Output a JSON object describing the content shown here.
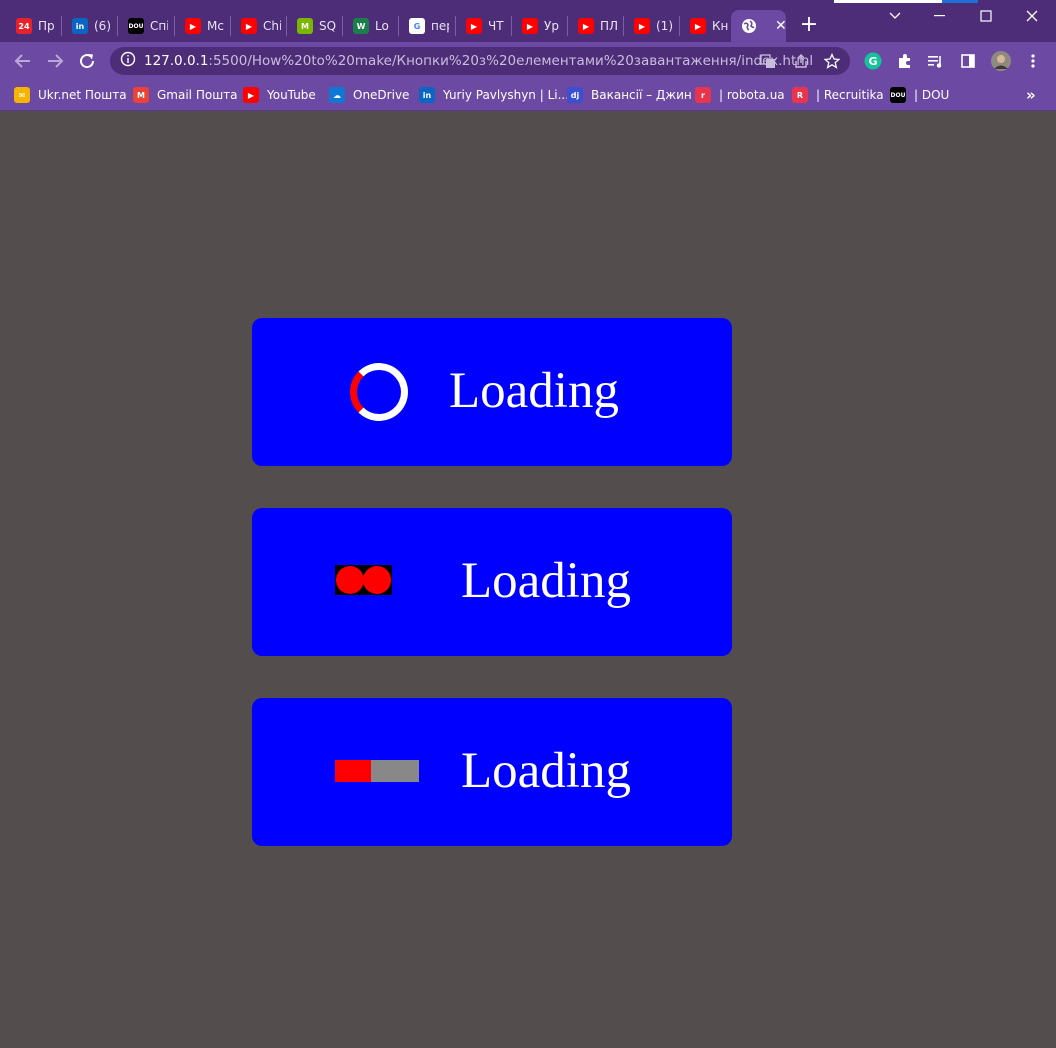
{
  "browser": {
    "tabs": [
      {
        "label": "Пр",
        "icon": "news24-icon",
        "color": "#e8222a",
        "glyph": "24"
      },
      {
        "label": "(6)",
        "icon": "linkedin-icon",
        "color": "#0a66c2",
        "glyph": "in"
      },
      {
        "label": "Спі",
        "icon": "dou-icon",
        "color": "#000000",
        "glyph": "DOU"
      },
      {
        "label": "Mc",
        "icon": "youtube-icon",
        "color": "#ff0000",
        "glyph": "▶"
      },
      {
        "label": "Chi",
        "icon": "youtube-icon",
        "color": "#ff0000",
        "glyph": "▶"
      },
      {
        "label": "SQ",
        "icon": "m-logo-icon",
        "color": "#7ab800",
        "glyph": "M"
      },
      {
        "label": "Lo",
        "icon": "w-logo-icon",
        "color": "#1a7f4b",
        "glyph": "W"
      },
      {
        "label": "пер",
        "icon": "google-icon",
        "color": "#ffffff",
        "glyph": "G"
      },
      {
        "label": "ЧТ",
        "icon": "youtube-icon",
        "color": "#ff0000",
        "glyph": "▶"
      },
      {
        "label": "Ур",
        "icon": "youtube-icon",
        "color": "#ff0000",
        "glyph": "▶"
      },
      {
        "label": "ПЛ",
        "icon": "youtube-icon",
        "color": "#ff0000",
        "glyph": "▶"
      },
      {
        "label": "(1)",
        "icon": "youtube-icon",
        "color": "#ff0000",
        "glyph": "▶"
      },
      {
        "label": "Кн",
        "icon": "youtube-icon",
        "color": "#ff0000",
        "glyph": "▶"
      }
    ],
    "active_tab": {
      "icon": "globe-icon",
      "close": "✕"
    },
    "new_tab": "+",
    "url_host": "127.0.0.1",
    "url_rest": ":5500/How%20to%20make/Кнопки%20з%20елементами%20завантаження/index.html",
    "bookmarks": [
      {
        "label": "Ukr.net Пошта",
        "icon": "ukrnet-icon",
        "color": "#f4b400",
        "glyph": "✉"
      },
      {
        "label": "Gmail Пошта",
        "icon": "gmail-icon",
        "color": "#ea4335",
        "glyph": "M"
      },
      {
        "label": "YouTube",
        "icon": "youtube-icon",
        "color": "#ff0000",
        "glyph": "▶"
      },
      {
        "label": "OneDrive",
        "icon": "onedrive-icon",
        "color": "#0f78d4",
        "glyph": "☁"
      },
      {
        "label": "Yuriy Pavlyshyn | Li...",
        "icon": "linkedin-icon",
        "color": "#0a66c2",
        "glyph": "in"
      },
      {
        "label": "Вакансії – Джин",
        "icon": "djinni-icon",
        "color": "#3b4fd1",
        "glyph": "dj"
      },
      {
        "label": "| robota.ua",
        "icon": "robota-icon",
        "color": "#e8354b",
        "glyph": "r"
      },
      {
        "label": "| Recruitika",
        "icon": "recruitika-icon",
        "color": "#e8354b",
        "glyph": "R"
      },
      {
        "label": "| DOU",
        "icon": "dou-icon",
        "color": "#000000",
        "glyph": "DOU"
      }
    ],
    "more_bookmarks": "»"
  },
  "page": {
    "buttons": [
      {
        "label": "Loading",
        "indicator": "spinner"
      },
      {
        "label": "Loading",
        "indicator": "dots"
      },
      {
        "label": "Loading",
        "indicator": "progress-bar",
        "progress": 0.43
      }
    ],
    "colors": {
      "button": "#0000ff",
      "indicator": "#ff0000",
      "background": "#534e4d"
    }
  }
}
